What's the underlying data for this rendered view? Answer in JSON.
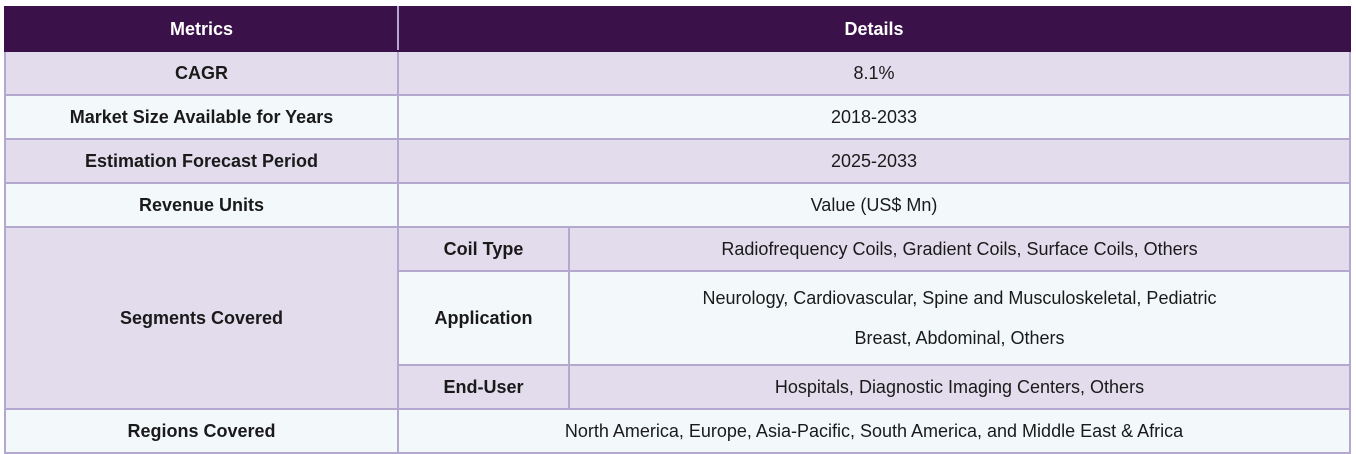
{
  "table": {
    "headers": [
      "Metrics",
      "Details"
    ],
    "rows": [
      {
        "label": "CAGR",
        "value": "8.1%"
      },
      {
        "label": "Market Size Available for Years",
        "value": "2018-2033"
      },
      {
        "label": "Estimation Forecast Period",
        "value": "2025-2033"
      },
      {
        "label": "Revenue Units",
        "value": "Value (US$ Mn)"
      }
    ],
    "segments": {
      "label": "Segments Covered",
      "items": [
        {
          "name": "Coil Type",
          "value": "Radiofrequency Coils, Gradient Coils, Surface Coils, Others"
        },
        {
          "name": "Application",
          "value_line1": "Neurology, Cardiovascular, Spine and Musculoskeletal, Pediatric",
          "value_line2": "Breast, Abdominal, Others"
        },
        {
          "name": "End-User",
          "value": "Hospitals, Diagnostic Imaging Centers, Others"
        }
      ]
    },
    "regions": {
      "label": "Regions Covered",
      "value": "North America, Europe, Asia-Pacific, South America, and Middle East & Africa"
    }
  },
  "colors": {
    "header_bg": "#3a1148",
    "row_lavender": "#e2dcec",
    "row_light": "#f3f9fb",
    "border": "#b5a8cf"
  }
}
